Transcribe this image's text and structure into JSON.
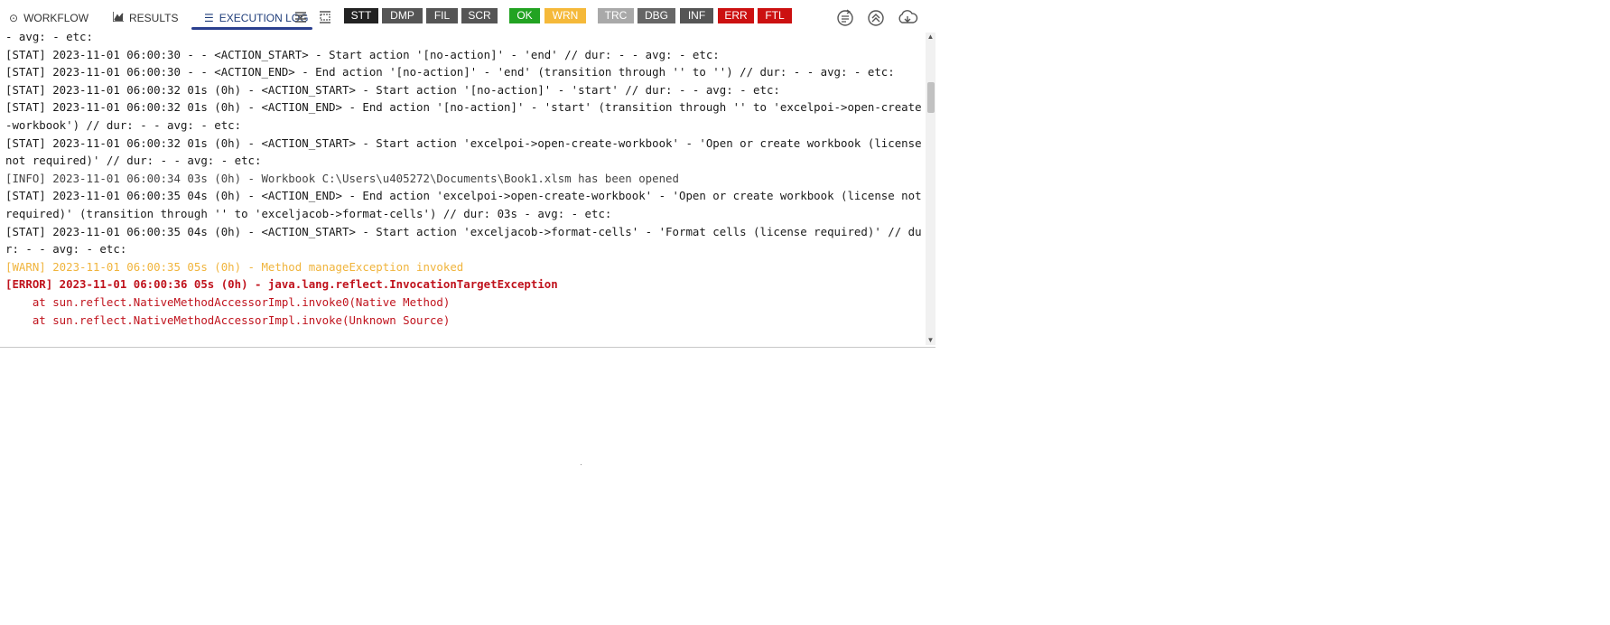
{
  "tabs": [
    {
      "label": "WORKFLOW",
      "icon": "target-icon"
    },
    {
      "label": "RESULTS",
      "icon": "chart-icon"
    },
    {
      "label": "EXECUTION LOG",
      "icon": "list-icon"
    }
  ],
  "badges": [
    {
      "label": "STT",
      "color": "#222222"
    },
    {
      "label": "DMP",
      "color": "#555555"
    },
    {
      "label": "FIL",
      "color": "#555555"
    },
    {
      "label": "SCR",
      "color": "#555555"
    },
    {
      "label": "OK",
      "color": "#22a322"
    },
    {
      "label": "WRN",
      "color": "#f5b93a"
    },
    {
      "label": "TRC",
      "color": "#a9a9a9"
    },
    {
      "label": "DBG",
      "color": "#666666"
    },
    {
      "label": "INF",
      "color": "#555555"
    },
    {
      "label": "ERR",
      "color": "#cc1010"
    },
    {
      "label": "FTL",
      "color": "#cc1010"
    }
  ],
  "toolbar_icons": [
    "collapse-lines-icon",
    "expand-lines-icon",
    "refresh-icon",
    "scroll-top-icon",
    "download-icon"
  ],
  "log": [
    {
      "level": "stat",
      "text": "- avg: - etc:"
    },
    {
      "level": "stat",
      "text": "[STAT] 2023-11-01 06:00:30 - - <ACTION_START> - Start action '[no-action]' - 'end' // dur: - - avg: - etc:"
    },
    {
      "level": "stat",
      "text": "[STAT] 2023-11-01 06:00:30 - - <ACTION_END> - End action '[no-action]' - 'end' (transition through '' to '') // dur: - - avg: - etc:"
    },
    {
      "level": "stat",
      "text": "[STAT] 2023-11-01 06:00:32 01s (0h) - <ACTION_START> - Start action '[no-action]' - 'start' // dur: - - avg: - etc:"
    },
    {
      "level": "stat",
      "text": "[STAT] 2023-11-01 06:00:32 01s (0h) - <ACTION_END> - End action '[no-action]' - 'start' (transition through '' to 'excelpoi->open-create-workbook') // dur: - - avg: - etc:"
    },
    {
      "level": "stat",
      "text": "[STAT] 2023-11-01 06:00:32 01s (0h) - <ACTION_START> - Start action 'excelpoi->open-create-workbook' - 'Open or create workbook (license not required)' // dur: - - avg: - etc:"
    },
    {
      "level": "info",
      "text": "[INFO] 2023-11-01 06:00:34 03s (0h) - Workbook C:\\Users\\u405272\\Documents\\Book1.xlsm has been opened"
    },
    {
      "level": "stat",
      "text": "[STAT] 2023-11-01 06:00:35 04s (0h) - <ACTION_END> - End action 'excelpoi->open-create-workbook' - 'Open or create workbook (license not required)' (transition through '' to 'exceljacob->format-cells') // dur: 03s - avg: - etc:"
    },
    {
      "level": "stat",
      "text": "[STAT] 2023-11-01 06:00:35 04s (0h) - <ACTION_START> - Start action 'exceljacob->format-cells' - 'Format cells (license required)' // dur: - - avg: - etc:"
    },
    {
      "level": "warn",
      "text": "[WARN] 2023-11-01 06:00:35 05s (0h) - Method manageException invoked"
    },
    {
      "level": "error",
      "text": "[ERROR] 2023-11-01 06:00:36 05s (0h) - java.lang.reflect.InvocationTargetException"
    },
    {
      "level": "trace",
      "text": "    at sun.reflect.NativeMethodAccessorImpl.invoke0(Native Method)"
    },
    {
      "level": "trace",
      "text": "    at sun.reflect.NativeMethodAccessorImpl.invoke(Unknown Source)"
    }
  ]
}
